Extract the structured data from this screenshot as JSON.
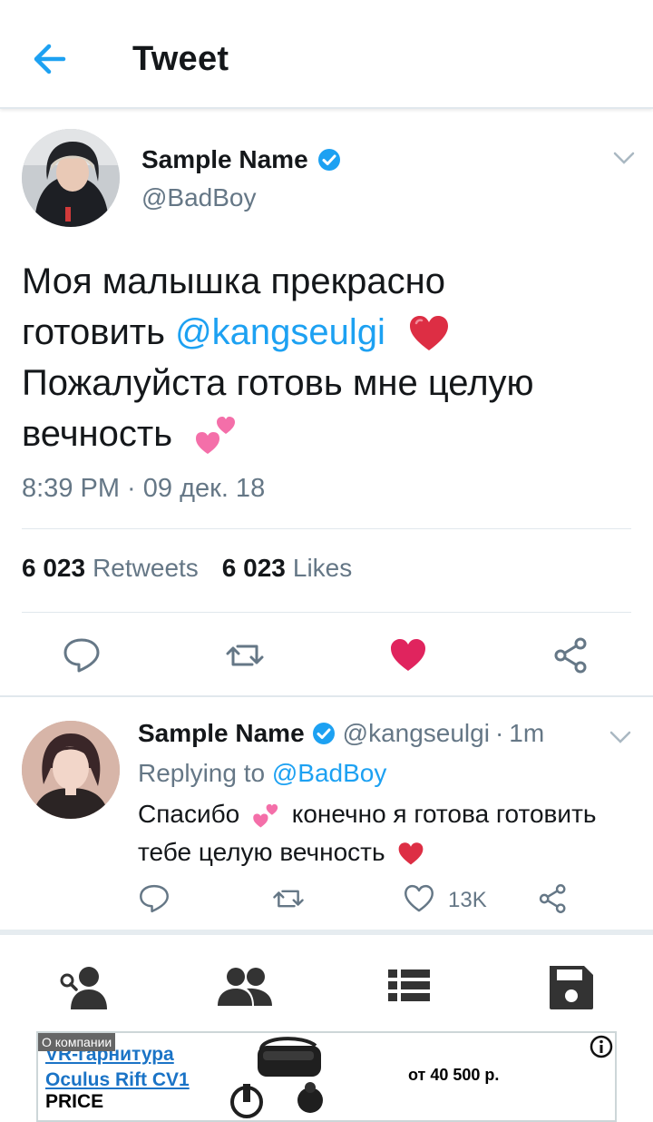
{
  "header": {
    "title": "Tweet"
  },
  "tweet": {
    "name": "Sample Name",
    "handle": "@BadBoy",
    "text_line1": "Моя малышка прекрасно",
    "text_line2_prefix": "готовить ",
    "mention": "@kangseulgi",
    "text_line3": "Пожалуйста готовь мне целую",
    "text_line4": "вечность",
    "timestamp": "8:39 PM · 09 дек. 18",
    "retweets_count": "6 023",
    "retweets_label": "Retweets",
    "likes_count": "6 023",
    "likes_label": "Likes",
    "liked": true
  },
  "reply": {
    "name": "Sample Name",
    "handle": "@kangseulgi",
    "dot": "·",
    "time": "1m",
    "replying_to_label": "Replying to",
    "replying_to_handle": "@BadBoy",
    "text_part1": "Спасибо",
    "text_part2": "конечно я готова готовить тебе целую вечность",
    "like_count": "13K"
  },
  "ad": {
    "tag": "О компании",
    "title_line1": "VR-гарнитура",
    "title_line2": "Oculus Rift CV1",
    "price_label": "PRICE",
    "price": "от 40 500 р."
  },
  "colors": {
    "accent": "#1da1f2",
    "like": "#e0245e",
    "secondary_text": "#657786",
    "border": "#e1e8ed"
  }
}
